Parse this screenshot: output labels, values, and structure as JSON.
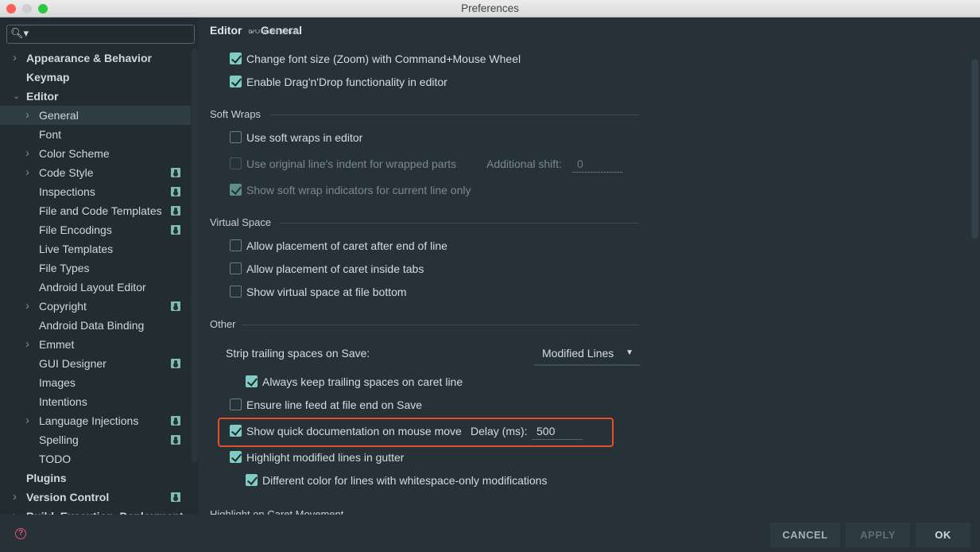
{
  "window": {
    "title": "Preferences"
  },
  "search": {
    "placeholder": "",
    "icon": "search-icon"
  },
  "sidebar": {
    "items": [
      {
        "label": "Appearance & Behavior",
        "level": 0,
        "arrow": "right",
        "badge": false,
        "bold": true
      },
      {
        "label": "Keymap",
        "level": 0,
        "arrow": "none",
        "badge": false,
        "bold": true
      },
      {
        "label": "Editor",
        "level": 0,
        "arrow": "down",
        "badge": false,
        "bold": true
      },
      {
        "label": "General",
        "level": 1,
        "arrow": "right",
        "badge": false,
        "selected": true
      },
      {
        "label": "Font",
        "level": 1,
        "arrow": "none",
        "badge": false
      },
      {
        "label": "Color Scheme",
        "level": 1,
        "arrow": "right",
        "badge": false
      },
      {
        "label": "Code Style",
        "level": 1,
        "arrow": "right",
        "badge": true
      },
      {
        "label": "Inspections",
        "level": 1,
        "arrow": "none",
        "badge": true
      },
      {
        "label": "File and Code Templates",
        "level": 1,
        "arrow": "none",
        "badge": true
      },
      {
        "label": "File Encodings",
        "level": 1,
        "arrow": "none",
        "badge": true
      },
      {
        "label": "Live Templates",
        "level": 1,
        "arrow": "none",
        "badge": false
      },
      {
        "label": "File Types",
        "level": 1,
        "arrow": "none",
        "badge": false
      },
      {
        "label": "Android Layout Editor",
        "level": 1,
        "arrow": "none",
        "badge": false
      },
      {
        "label": "Copyright",
        "level": 1,
        "arrow": "right",
        "badge": true
      },
      {
        "label": "Android Data Binding",
        "level": 1,
        "arrow": "none",
        "badge": false
      },
      {
        "label": "Emmet",
        "level": 1,
        "arrow": "right",
        "badge": false
      },
      {
        "label": "GUI Designer",
        "level": 1,
        "arrow": "none",
        "badge": true
      },
      {
        "label": "Images",
        "level": 1,
        "arrow": "none",
        "badge": false
      },
      {
        "label": "Intentions",
        "level": 1,
        "arrow": "none",
        "badge": false
      },
      {
        "label": "Language Injections",
        "level": 1,
        "arrow": "right",
        "badge": true
      },
      {
        "label": "Spelling",
        "level": 1,
        "arrow": "none",
        "badge": true
      },
      {
        "label": "TODO",
        "level": 1,
        "arrow": "none",
        "badge": false
      },
      {
        "label": "Plugins",
        "level": 0,
        "arrow": "none",
        "badge": false,
        "bold": true
      },
      {
        "label": "Version Control",
        "level": 0,
        "arrow": "right",
        "badge": true,
        "bold": true
      },
      {
        "label": "Build, Execution, Deployment",
        "level": 0,
        "arrow": "right",
        "badge": false,
        "bold": true
      }
    ]
  },
  "breadcrumb": {
    "parent": "Editor",
    "separator": "›",
    "current": "General"
  },
  "main": {
    "top_partial": "Double click",
    "change_font_zoom": {
      "label": "Change font size (Zoom) with Command+Mouse Wheel",
      "checked": true
    },
    "drag_drop": {
      "label": "Enable Drag'n'Drop functionality in editor",
      "checked": true
    },
    "soft_wraps": {
      "title": "Soft Wraps",
      "use_soft_wraps": {
        "label": "Use soft wraps in editor",
        "checked": false
      },
      "original_indent": {
        "label": "Use original line's indent for wrapped parts",
        "checked": false,
        "disabled": true
      },
      "additional_shift_label": "Additional shift:",
      "additional_shift_value": "0",
      "indicators": {
        "label": "Show soft wrap indicators for current line only",
        "checked": true,
        "disabled": true
      }
    },
    "virtual_space": {
      "title": "Virtual Space",
      "after_end": {
        "label": "Allow placement of caret after end of line",
        "checked": false
      },
      "inside_tabs": {
        "label": "Allow placement of caret inside tabs",
        "checked": false
      },
      "file_bottom": {
        "label": "Show virtual space at file bottom",
        "checked": false
      }
    },
    "other": {
      "title": "Other",
      "strip_label": "Strip trailing spaces on Save:",
      "strip_value": "Modified Lines",
      "keep_trailing": {
        "label": "Always keep trailing spaces on caret line",
        "checked": true
      },
      "line_feed": {
        "label": "Ensure line feed at file end on Save",
        "checked": false
      },
      "quick_doc": {
        "label": "Show quick documentation on mouse move",
        "checked": true
      },
      "delay_label": "Delay (ms):",
      "delay_value": "500",
      "highlight_modified": {
        "label": "Highlight modified lines in gutter",
        "checked": true
      },
      "different_color": {
        "label": "Different color for lines with whitespace-only modifications",
        "checked": true
      }
    },
    "next_section": "Highlight on Caret Movement"
  },
  "footer": {
    "cancel": "CANCEL",
    "apply": "APPLY",
    "ok": "OK",
    "help": "?"
  },
  "colors": {
    "accent": "#80cbc4",
    "highlight_box": "#e5502c",
    "background": "#263238"
  }
}
